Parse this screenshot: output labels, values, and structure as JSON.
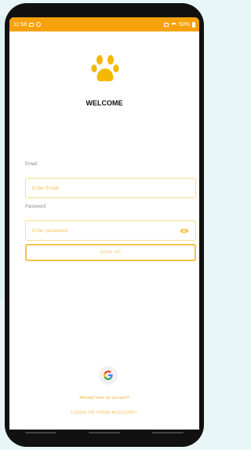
{
  "status_bar": {
    "time": "11:58",
    "battery": "50%"
  },
  "app": {
    "welcome": "WELCOME",
    "brand_color": "#f7a20d"
  },
  "form": {
    "email_label": "Email",
    "email_placeholder": "Enter Email",
    "password_label": "Password",
    "password_placeholder": "Enter password",
    "signup_label": "SIGN UP"
  },
  "footer": {
    "already_text": "Already have an account?",
    "login_label": "LOGIN TO YOUR ACCOUNT!"
  },
  "icons": {
    "logo": "paw-icon",
    "show_password": "eye-icon",
    "google": "google-icon"
  }
}
